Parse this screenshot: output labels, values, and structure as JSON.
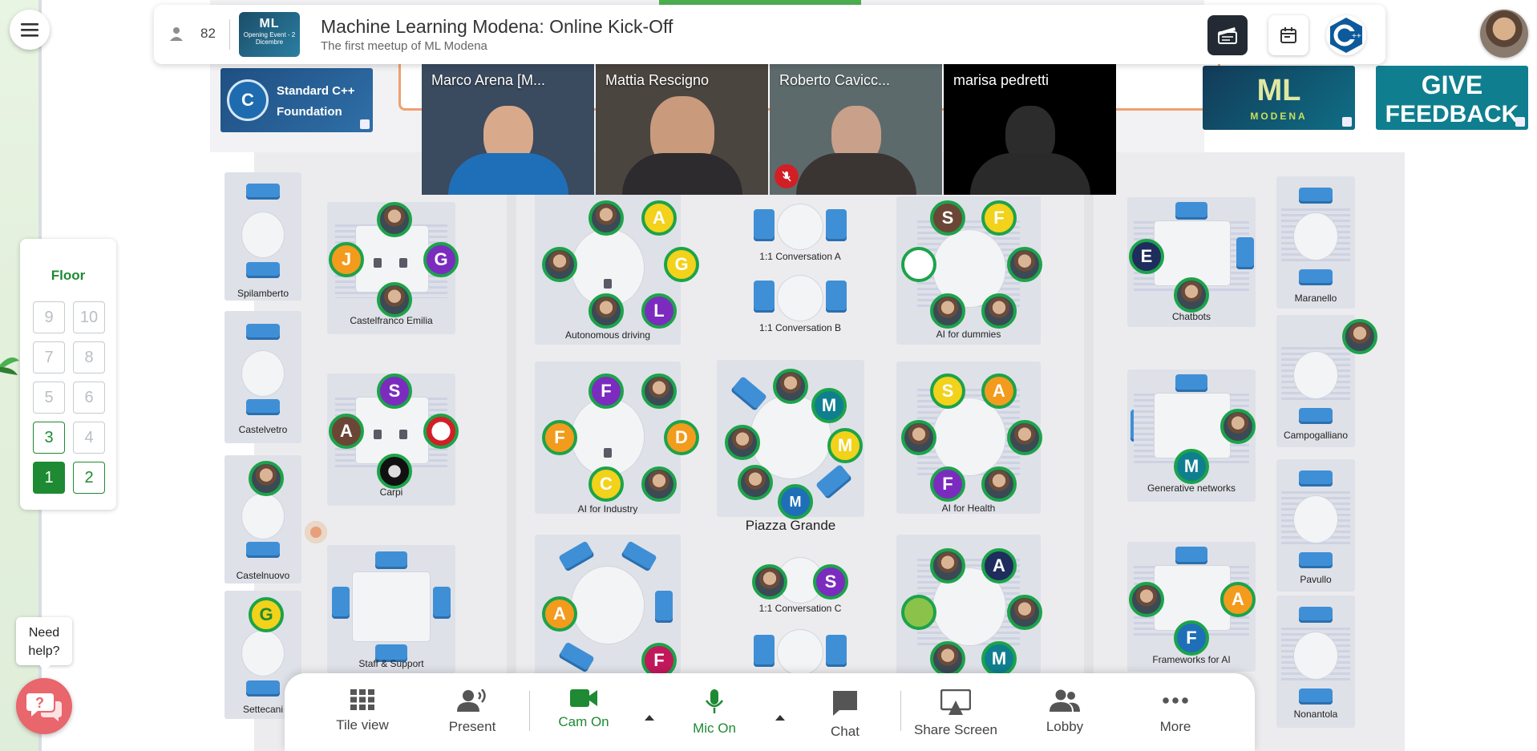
{
  "header": {
    "participant_count": "82",
    "event_title": "Machine Learning Modena: Online Kick-Off",
    "event_subtitle": "The first meetup of ML Modena",
    "event_logo_title": "ML",
    "event_logo_subtitle": "Opening Event - 2 Dicembre"
  },
  "banners": {
    "cpp_foundation_line1": "Standard C++",
    "cpp_foundation_line2": "Foundation",
    "ml_modena": "ML",
    "ml_modena_sub": "MODENA",
    "give_feedback_line1": "GIVE",
    "give_feedback_line2": "FEEDBACK"
  },
  "video_tiles": [
    {
      "name": "Marco Arena [M...",
      "bg": "#3a4a5f",
      "shirt": "#1f6fb8",
      "muted": false
    },
    {
      "name": "Mattia Rescigno",
      "bg": "#4b4540",
      "shirt": "#2d2b2e",
      "muted": false
    },
    {
      "name": "Roberto Cavicc...",
      "bg": "#5d6a6c",
      "shirt": "#3a3533",
      "muted": true
    },
    {
      "name": "marisa pedretti",
      "bg": "#000000",
      "shirt": "#2a2a2a",
      "muted": false
    }
  ],
  "floor": {
    "title": "Floor",
    "buttons": [
      {
        "label": "9",
        "state": "disabled"
      },
      {
        "label": "10",
        "state": "disabled"
      },
      {
        "label": "7",
        "state": "disabled"
      },
      {
        "label": "8",
        "state": "disabled"
      },
      {
        "label": "5",
        "state": "disabled"
      },
      {
        "label": "6",
        "state": "disabled"
      },
      {
        "label": "3",
        "state": "available"
      },
      {
        "label": "4",
        "state": "disabled"
      },
      {
        "label": "1",
        "state": "active"
      },
      {
        "label": "2",
        "state": "available"
      }
    ]
  },
  "help": {
    "line1": "Need",
    "line2": "help?"
  },
  "rooms": {
    "spilamberto": "Spilamberto",
    "castelfranco": "Castelfranco Emilia",
    "castelvetro": "Castelvetro",
    "carpi": "Carpi",
    "castelnuovo": "Castelnuovo",
    "settecani": "Settecani",
    "staff_support": "Staff & Support",
    "autonomous": "Autonomous driving",
    "ai_industry": "AI for Industry",
    "conv_a": "1:1 Conversation A",
    "conv_b": "1:1 Conversation B",
    "conv_c": "1:1 Conversation C",
    "piazza_grande": "Piazza Grande",
    "ai_dummies": "AI for dummies",
    "ai_health": "AI for Health",
    "chatbots": "Chatbots",
    "generative": "Generative networks",
    "frameworks": "Frameworks for AI",
    "maranello": "Maranello",
    "campogalliano": "Campogalliano",
    "pavullo": "Pavullo",
    "nonantola": "Nonantola"
  },
  "avatars": {
    "cf_j": "J",
    "cf_g": "G",
    "carpi_s": "S",
    "carpi_a": "A",
    "cn_g": "G",
    "ad_a": "A",
    "ad_g": "G",
    "ad_l": "L",
    "ai_f1": "F",
    "ai_f2": "F",
    "ai_d": "D",
    "ai_c": "C",
    "pg_m1": "M",
    "pg_m2": "M",
    "pg_m3": "M",
    "staff_a": "A",
    "staff_f": "F",
    "cc_s": "S",
    "dm_s": "S",
    "dm_f": "F",
    "ah_s": "S",
    "ah_a": "A",
    "ah_f": "F",
    "ai2_a": "A",
    "ai2_m": "M",
    "cb_e": "E",
    "gn_m": "M",
    "fw_a": "A",
    "fw_f": "F"
  },
  "toolbar": {
    "tile_view": "Tile view",
    "present": "Present",
    "cam_on": "Cam On",
    "mic_on": "Mic On",
    "chat": "Chat",
    "share_screen": "Share Screen",
    "lobby": "Lobby",
    "more": "More"
  },
  "colors": {
    "accent_green": "#1e8a33",
    "orange": "#f29b1d",
    "yellow": "#f2d21a",
    "purple": "#7b2cbf",
    "navy": "#1e2d5c",
    "teal": "#0f7f8f",
    "brown": "#6b4636",
    "crimson": "#c2185b",
    "muted_red": "#d21f26"
  }
}
